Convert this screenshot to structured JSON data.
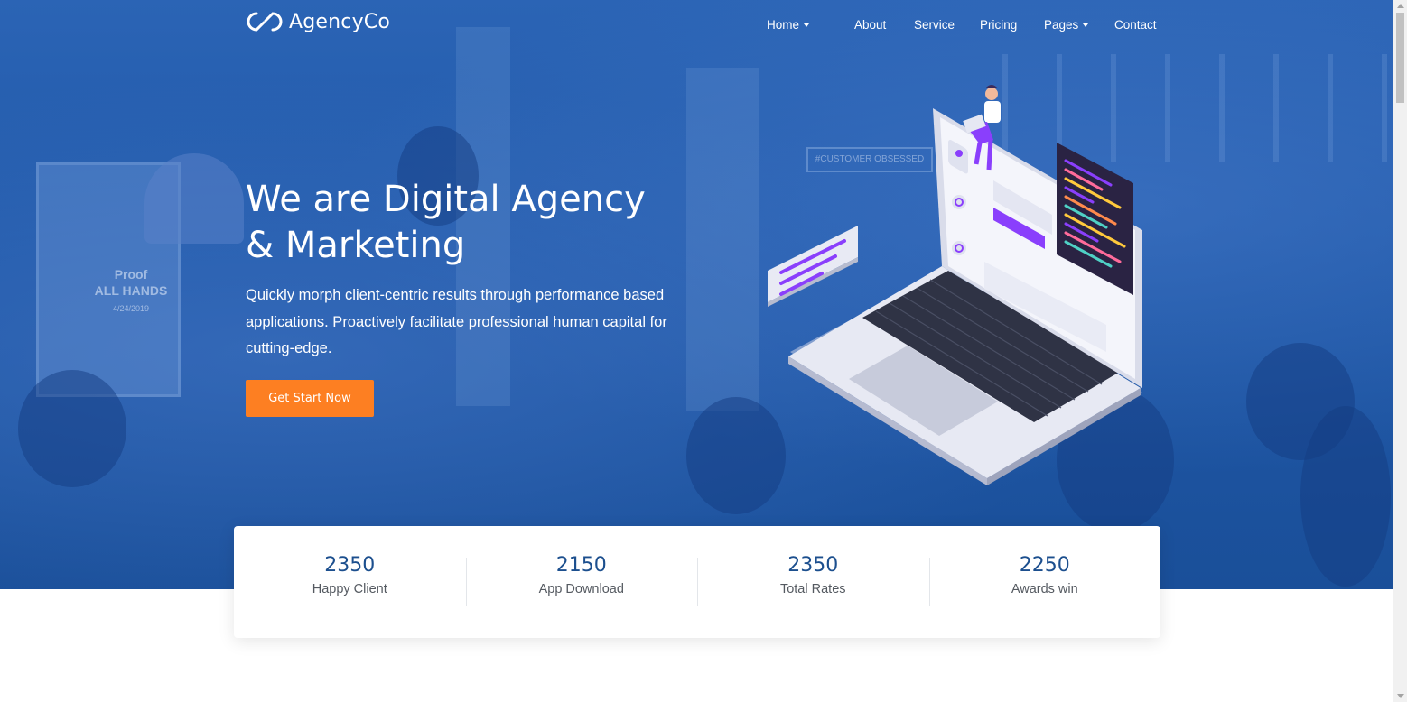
{
  "brand": {
    "name": "AgencyCo",
    "logo_icon": "infinity-loop-icon"
  },
  "nav": {
    "items": [
      {
        "label": "Home",
        "has_dropdown": true
      },
      {
        "label": "About",
        "has_dropdown": false
      },
      {
        "label": "Service",
        "has_dropdown": false
      },
      {
        "label": "Pricing",
        "has_dropdown": false
      },
      {
        "label": "Pages",
        "has_dropdown": true
      },
      {
        "label": "Contact",
        "has_dropdown": false
      }
    ]
  },
  "hero": {
    "headline_line1": "We are Digital Agency",
    "headline_line2": "& Marketing",
    "subtitle": "Quickly morph client-centric results through performance based applications. Proactively facilitate professional human capital for cutting-edge.",
    "cta_label": "Get Start Now",
    "background_scene_text": {
      "proof": "Proof",
      "all_hands": "ALL HANDS",
      "date": "4/24/2019",
      "banner": "#CUSTOMER OBSESSED"
    }
  },
  "stats": [
    {
      "value": "2350",
      "label": "Happy Client"
    },
    {
      "value": "2150",
      "label": "App Download"
    },
    {
      "value": "2350",
      "label": "Total Rates"
    },
    {
      "value": "2250",
      "label": "Awards win"
    }
  ],
  "colors": {
    "hero_blue": "#1f58a8",
    "cta_orange": "#fd7f22",
    "stat_number": "#1c4f8e",
    "illustration_purple": "#8a3ffc"
  }
}
